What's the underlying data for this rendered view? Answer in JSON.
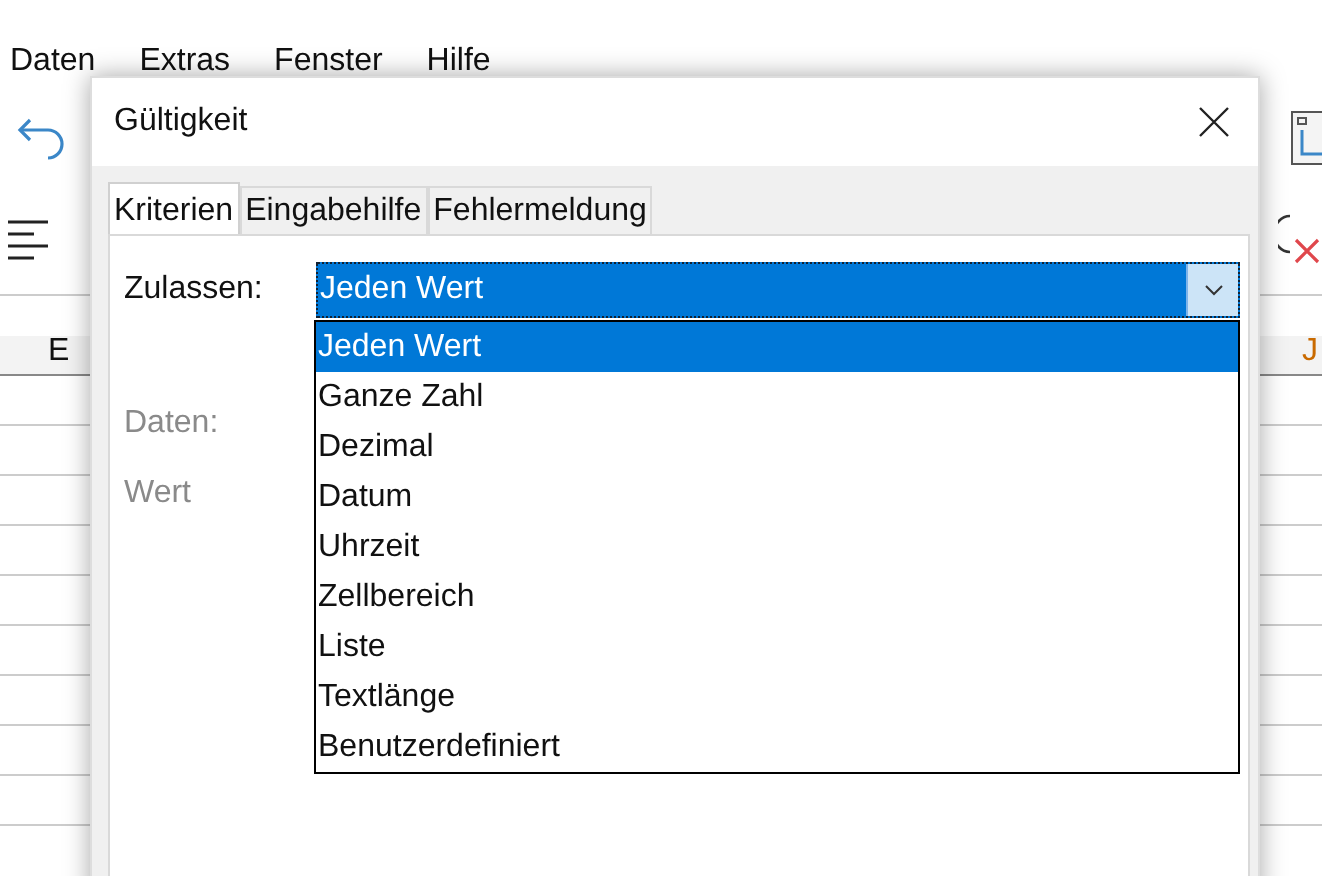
{
  "menu": [
    "Daten",
    "Extras",
    "Fenster",
    "Hilfe"
  ],
  "sheet": {
    "column_headers": [
      "E",
      "J"
    ]
  },
  "dialog": {
    "title": "Gültigkeit",
    "tabs": [
      {
        "label": "Kriterien",
        "selected": true
      },
      {
        "label": "Eingabehilfe",
        "selected": false
      },
      {
        "label": "Fehlermeldung",
        "selected": false
      }
    ],
    "allow": {
      "label": "Zulassen:",
      "value": "Jeden Wert",
      "expanded": true,
      "options": [
        {
          "label": "Jeden Wert",
          "selected": true
        },
        {
          "label": "Ganze Zahl",
          "selected": false
        },
        {
          "label": "Dezimal",
          "selected": false
        },
        {
          "label": "Datum",
          "selected": false
        },
        {
          "label": "Uhrzeit",
          "selected": false
        },
        {
          "label": "Zellbereich",
          "selected": false
        },
        {
          "label": "Liste",
          "selected": false
        },
        {
          "label": "Textlänge",
          "selected": false
        },
        {
          "label": "Benutzerdefiniert",
          "selected": false
        }
      ]
    },
    "fields": [
      {
        "label": "Daten:",
        "disabled": true
      },
      {
        "label": "Wert",
        "disabled": true
      }
    ]
  }
}
